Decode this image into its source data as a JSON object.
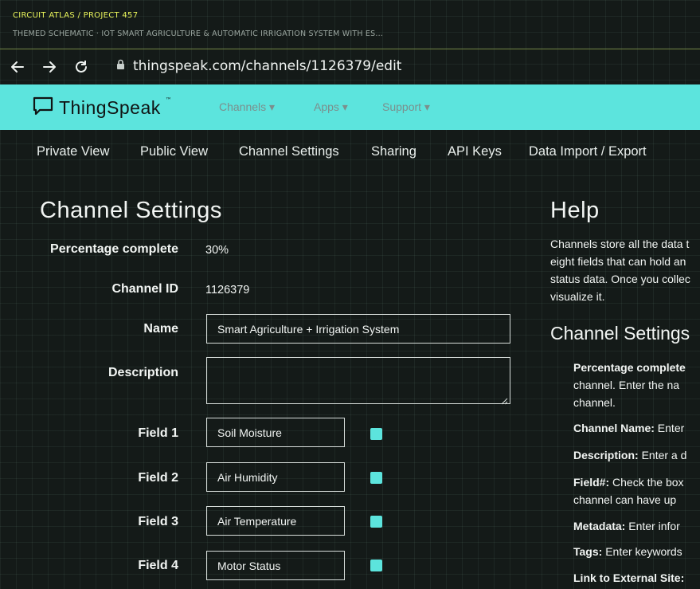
{
  "header": {
    "crumb": "CIRCUIT ATLAS / PROJECT 457",
    "subtitle": "THEMED SCHEMATIC · IOT SMART AGRICULTURE & AUTOMATIC IRRIGATION SYSTEM WITH ES..."
  },
  "browser": {
    "url": "thingspeak.com/channels/1126379/edit",
    "icons": [
      "back-arrow-icon",
      "forward-arrow-icon",
      "reload-icon",
      "lock-icon"
    ]
  },
  "ts": {
    "brand": "ThingSpeak",
    "tm": "™",
    "nav": [
      "Channels ▾",
      "Apps ▾",
      "Support ▾"
    ],
    "tabs": [
      "Private View",
      "Public View",
      "Channel Settings",
      "Sharing",
      "API Keys",
      "Data Import / Export"
    ]
  },
  "form": {
    "title": "Channel Settings",
    "percent_label": "Percentage complete",
    "percent_value": "30%",
    "channel_id_label": "Channel ID",
    "channel_id_value": "1126379",
    "name_label": "Name",
    "name_value": "Smart Agriculture + Irrigation System",
    "description_label": "Description",
    "description_value": "",
    "fields": [
      {
        "label": "Field 1",
        "value": "Soil Moisture",
        "checked": true
      },
      {
        "label": "Field 2",
        "value": "Air Humidity",
        "checked": true
      },
      {
        "label": "Field 3",
        "value": "Air Temperature",
        "checked": true
      },
      {
        "label": "Field 4",
        "value": "Motor Status",
        "checked": true
      }
    ]
  },
  "help": {
    "title": "Help",
    "para_lines": [
      "Channels store all the data t",
      "eight fields that can hold an",
      "status data. Once you collec",
      "visualize it."
    ],
    "settings_title": "Channel Settings",
    "bullets": [
      {
        "bold": "Percentage complete",
        "rest": "",
        "extra_lines": [
          "channel. Enter the na",
          "channel."
        ]
      },
      {
        "bold": "Channel Name:",
        "rest": " Enter",
        "extra_lines": []
      },
      {
        "bold": "Description:",
        "rest": " Enter a d",
        "extra_lines": []
      },
      {
        "bold": "Field#:",
        "rest": " Check the box",
        "extra_lines": [
          "channel can have up"
        ]
      },
      {
        "bold": "Metadata:",
        "rest": " Enter infor",
        "extra_lines": []
      },
      {
        "bold": "Tags:",
        "rest": " Enter keywords",
        "extra_lines": []
      },
      {
        "bold": "Link to External Site:",
        "rest": "",
        "extra_lines": []
      }
    ]
  },
  "colors": {
    "accent": "#5ce4dd",
    "crumb": "#e7f25a",
    "background": "#141a18"
  }
}
